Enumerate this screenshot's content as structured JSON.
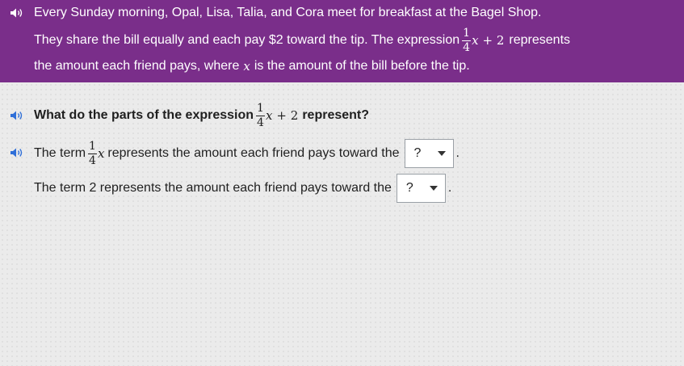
{
  "banner": {
    "line1": "Every Sunday morning, Opal, Lisa, Talia, and Cora meet for breakfast at the Bagel Shop.",
    "line2_before": "They share the bill equally and each pay $2 toward the tip. The expression",
    "line2_after": "represents",
    "line3_before": "the amount each friend pays, where",
    "line3_var": "x",
    "line3_after": "is the amount of the bill before the tip."
  },
  "expression": {
    "numerator": "1",
    "denominator": "4",
    "variable": "x",
    "plus_term": "+ 2"
  },
  "question": {
    "before": "What do the parts of the expression",
    "after": "represent?"
  },
  "answers": [
    {
      "before": "The term",
      "after": "represents the amount each friend pays toward the",
      "selected": "?",
      "period": "."
    },
    {
      "before": "The term 2 represents the amount each friend pays toward the",
      "selected": "?",
      "period": "."
    }
  ],
  "colors": {
    "banner": "#7a2e8a",
    "speaker_accent": "#2f6fd8"
  },
  "icons": [
    "speaker-icon"
  ]
}
